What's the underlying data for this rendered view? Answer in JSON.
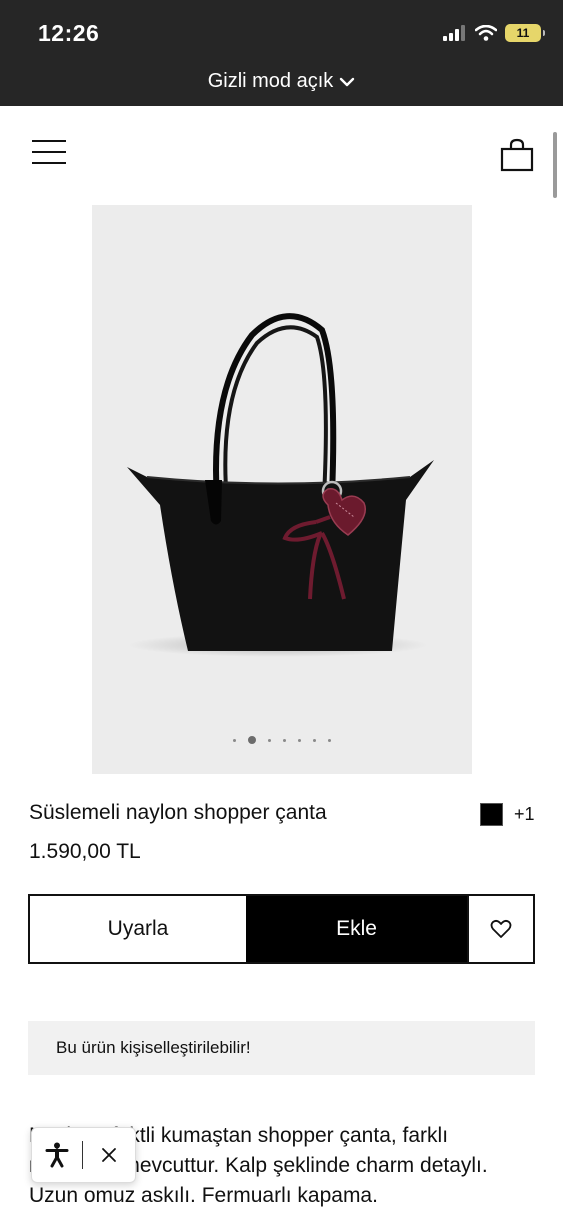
{
  "status_bar": {
    "time": "12:26",
    "battery": "11"
  },
  "private_mode": {
    "label": "Gizli mod açık"
  },
  "product": {
    "name": "Süslemeli naylon shopper çanta",
    "price": "1.590,00 TL",
    "extra_colors": "+1",
    "swatch_color": "#000000",
    "image_count": 7,
    "active_image": 2
  },
  "actions": {
    "notify_label": "Uyarla",
    "add_label": "Ekle"
  },
  "customizable_note": "Bu ürün kişiselleştirilebilir!",
  "description": "Naylon efektli kumaştan shopper çanta, farklı renklerde mevcuttur. Kalp şeklinde charm detaylı. Uzun omuz askılı. Fermuarlı kapama.",
  "colors": {
    "topbar": "#262626",
    "battery": "#e6d66a",
    "charm": "#7a1f33",
    "image_bg": "#ececec"
  }
}
